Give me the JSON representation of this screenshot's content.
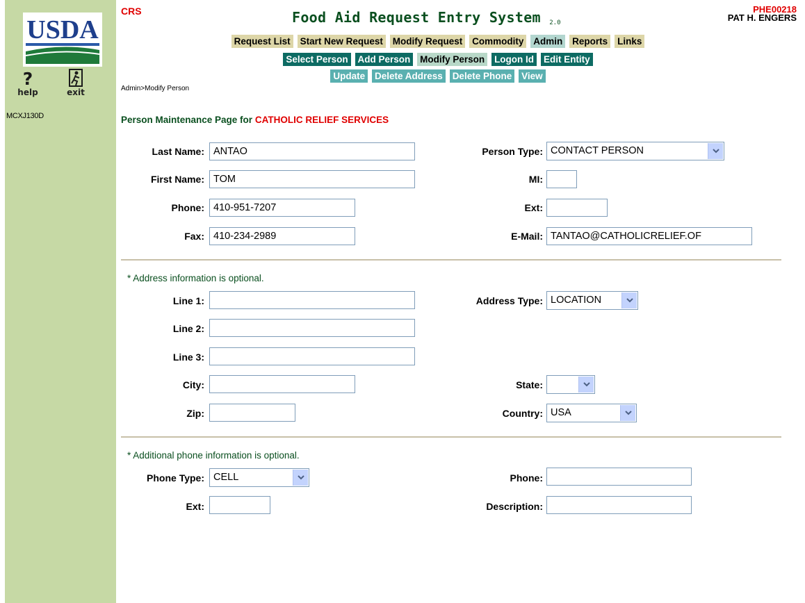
{
  "header": {
    "logo_text": "USDA",
    "org_code": "CRS",
    "app_title": "Food Aid Request Entry System",
    "app_version": "2.0",
    "user_code": "PHE00218",
    "user_name": "PAT H. ENGERS",
    "help_label": "help",
    "exit_label": "exit",
    "screen_id": "MCXJ130D"
  },
  "menu": {
    "main": [
      "Request List",
      "Start New Request",
      "Modify Request",
      "Commodity",
      "Admin",
      "Reports",
      "Links"
    ],
    "admin": [
      "Select Person",
      "Add Person",
      "Modify Person",
      "Logon Id",
      "Edit Entity"
    ],
    "admin_sub": [
      "Update",
      "Delete Address",
      "Delete Phone",
      "View"
    ]
  },
  "breadcrumb": "Admin>Modify Person",
  "page": {
    "heading_prefix": "Person Maintenance Page for",
    "org_name": "CATHOLIC RELIEF SERVICES"
  },
  "person": {
    "last_name_label": "Last Name:",
    "last_name": "ANTAO",
    "first_name_label": "First Name:",
    "first_name": "TOM",
    "phone_label": "Phone:",
    "phone": "410-951-7207",
    "fax_label": "Fax:",
    "fax": "410-234-2989",
    "person_type_label": "Person Type:",
    "person_type": "CONTACT PERSON",
    "mi_label": "MI:",
    "mi": "",
    "ext_label": "Ext:",
    "ext": "",
    "email_label": "E-Mail:",
    "email": "TANTAO@CATHOLICRELIEF.OF"
  },
  "address": {
    "note": "* Address information is optional.",
    "line1_label": "Line 1:",
    "line1": "",
    "line2_label": "Line 2:",
    "line2": "",
    "line3_label": "Line 3:",
    "line3": "",
    "city_label": "City:",
    "city": "",
    "zip_label": "Zip:",
    "zip": "",
    "address_type_label": "Address Type:",
    "address_type": "LOCATION",
    "state_label": "State:",
    "state": "",
    "country_label": "Country:",
    "country": "USA"
  },
  "additional_phone": {
    "note": "* Additional phone information is optional.",
    "phone_type_label": "Phone Type:",
    "phone_type": "CELL",
    "ext_label": "Ext:",
    "ext": "",
    "phone_label": "Phone:",
    "phone": "",
    "description_label": "Description:",
    "description": ""
  },
  "colors": {
    "sidebar": "#c6d9a5",
    "title_green": "#0a4f1f",
    "alert_red": "#e00000",
    "menu_tan": "#ddd6a8",
    "menu_dark_teal": "#0d6b63",
    "menu_light_teal": "#5ab0b0"
  },
  "icons": [
    "usda-logo",
    "help-question-icon",
    "exit-runner-icon",
    "chevron-down-icon"
  ]
}
